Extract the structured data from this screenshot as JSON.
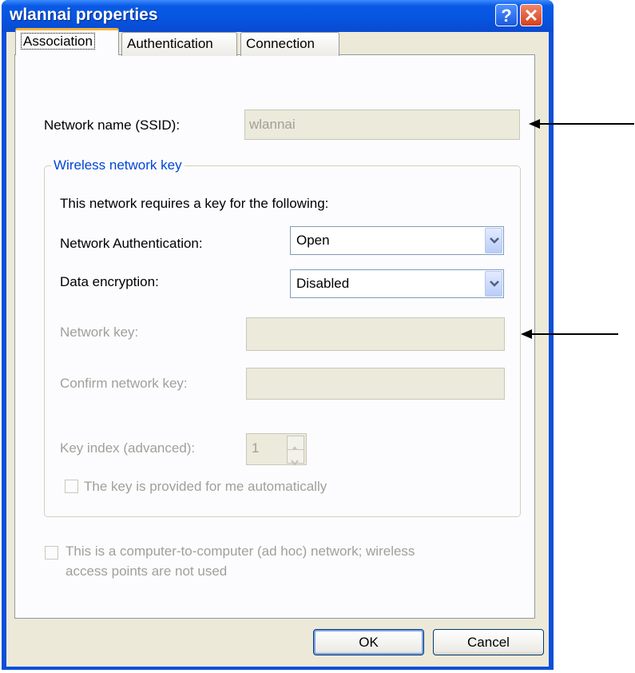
{
  "window": {
    "title": "wlannai properties",
    "help_glyph": "?",
    "close_glyph": "✕"
  },
  "tabs": [
    {
      "label": "Association",
      "selected": true
    },
    {
      "label": "Authentication",
      "selected": false
    },
    {
      "label": "Connection",
      "selected": false
    }
  ],
  "association": {
    "ssid_label": "Network name (SSID):",
    "ssid_value": "wlannai",
    "group_title": "Wireless network key",
    "intro_text": "This network requires a key for the following:",
    "auth_label": "Network Authentication:",
    "auth_value": "Open",
    "encryption_label": "Data encryption:",
    "encryption_value": "Disabled",
    "key_label": "Network key:",
    "key_value": "",
    "confirm_label": "Confirm network key:",
    "confirm_value": "",
    "key_index_label": "Key index (advanced):",
    "key_index_value": "1",
    "auto_key_label": "The key is provided for me automatically",
    "adhoc_label_line1": "This is a computer-to-computer (ad hoc) network; wireless",
    "adhoc_label_line2": "access points are not used"
  },
  "buttons": {
    "ok": "OK",
    "cancel": "Cancel"
  },
  "colors": {
    "titlebar": "#0a5ae6",
    "group_title": "#0046d5",
    "disabled_text": "#a0a09a",
    "dialog_bg": "#ece9d8"
  }
}
